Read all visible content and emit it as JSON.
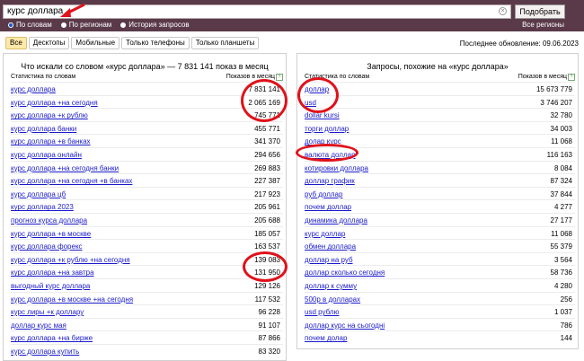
{
  "search": {
    "value": "курс доллара",
    "button": "Подобрать",
    "options": [
      "По словам",
      "По регионам",
      "История запросов"
    ],
    "all_regions": "Все регионы"
  },
  "tabs": [
    "Все",
    "Десктопы",
    "Мобильные",
    "Только телефоны",
    "Только планшеты"
  ],
  "updated": "Последнее обновление: 09.06.2023",
  "left": {
    "title": "Что искали со словом «курс доллара» — 7 831 141 показ в месяц",
    "col1": "Статистика по словам",
    "col2": "Показов в месяц",
    "rows": [
      {
        "q": "курс доллара",
        "n": "7 831 141"
      },
      {
        "q": "курс доллара +на сегодня",
        "n": "2 065 169"
      },
      {
        "q": "курс доллара +к рублю",
        "n": "745 771"
      },
      {
        "q": "курс доллара банки",
        "n": "455 771"
      },
      {
        "q": "курс доллара +в банках",
        "n": "341 370"
      },
      {
        "q": "курс доллара онлайн",
        "n": "294 656"
      },
      {
        "q": "курс доллара +на сегодня банки",
        "n": "269 883"
      },
      {
        "q": "курс доллара +на сегодня +в банках",
        "n": "227 387"
      },
      {
        "q": "курс доллара цб",
        "n": "217 923"
      },
      {
        "q": "курс доллара 2023",
        "n": "205 961"
      },
      {
        "q": "прогноз курса доллара",
        "n": "205 688"
      },
      {
        "q": "курс доллара +в москве",
        "n": "185 057"
      },
      {
        "q": "курс доллара форекс",
        "n": "163 537"
      },
      {
        "q": "курс доллара +к рублю +на сегодня",
        "n": "139 083"
      },
      {
        "q": "курс доллара +на завтра",
        "n": "131 950"
      },
      {
        "q": "выгодный курс доллара",
        "n": "129 126"
      },
      {
        "q": "курс доллара +в москве +на сегодня",
        "n": "117 532"
      },
      {
        "q": "курс лиры +к доллару",
        "n": "96 228"
      },
      {
        "q": "доллар курс мая",
        "n": "91 107"
      },
      {
        "q": "курс доллара +на бирже",
        "n": "87 866"
      },
      {
        "q": "курс доллара купить",
        "n": "83 320"
      }
    ]
  },
  "right": {
    "title": "Запросы, похожие на «курс доллара»",
    "col1": "Статистика по словам",
    "col2": "Показов в месяц",
    "rows": [
      {
        "q": "доллар",
        "n": "15 673 779"
      },
      {
        "q": "usd",
        "n": "3 746 207"
      },
      {
        "q": "dollar kursi",
        "n": "32 780"
      },
      {
        "q": "торги доллар",
        "n": "34 003"
      },
      {
        "q": "долар курс",
        "n": "11 068"
      },
      {
        "q": "валюта доллар",
        "n": "116 163"
      },
      {
        "q": "котировки доллара",
        "n": "8 084"
      },
      {
        "q": "доллар график",
        "n": "87 324"
      },
      {
        "q": "руб доллар",
        "n": "37 844"
      },
      {
        "q": "почем доллар",
        "n": "4 277"
      },
      {
        "q": "динамика доллара",
        "n": "27 177"
      },
      {
        "q": "курс доллар",
        "n": "11 068"
      },
      {
        "q": "обмен доллара",
        "n": "55 379"
      },
      {
        "q": "доллар на руб",
        "n": "3 564"
      },
      {
        "q": "доллар сколько сегодня",
        "n": "58 736"
      },
      {
        "q": "доллар к сумму",
        "n": "4 280"
      },
      {
        "q": "500р в долларах",
        "n": "256"
      },
      {
        "q": "usd рублю",
        "n": "1 037"
      },
      {
        "q": "доллар курс на сьогодні",
        "n": "786"
      },
      {
        "q": "почем долар",
        "n": "144"
      }
    ]
  },
  "annotation_color": "#e0121a"
}
